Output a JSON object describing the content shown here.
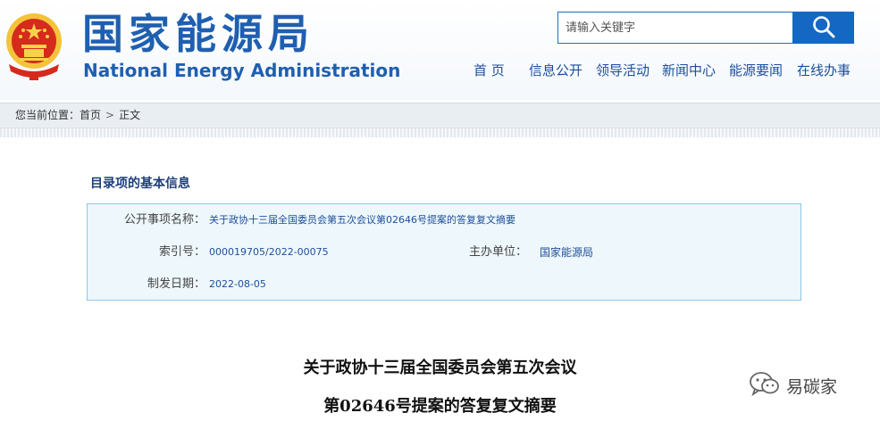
{
  "header": {
    "site_name_cn": "国家能源局",
    "site_name_en": "National Energy Administration"
  },
  "search": {
    "placeholder": "请输入关键字"
  },
  "nav": {
    "items": [
      "首 页",
      "信息公开",
      "领导活动",
      "新闻中心",
      "能源要闻",
      "在线办事"
    ]
  },
  "breadcrumb": {
    "prefix": "您当前位置：",
    "home": "首页",
    "separator": ">",
    "current": "正文"
  },
  "catalog": {
    "title": "目录项的基本信息",
    "name_label": "公开事项名称：",
    "name_value": "关于政协十三届全国委员会第五次会议第02646号提案的答复复文摘要",
    "index_label": "索引号：",
    "index_value": "000019705/2022-00075",
    "org_label": "主办单位：",
    "org_value": "国家能源局",
    "date_label": "制发日期：",
    "date_value": "2022-08-05"
  },
  "document": {
    "title_line1": "关于政协十三届全国委员会第五次会议",
    "title_line2": "第02646号提案的答复复文摘要"
  },
  "watermark": {
    "text": "易碳家"
  },
  "colors": {
    "brand_blue": "#1f5fb0",
    "search_button": "#1468c4",
    "info_box_bg": "#eef7fb",
    "info_box_border": "#8cc8e6"
  }
}
